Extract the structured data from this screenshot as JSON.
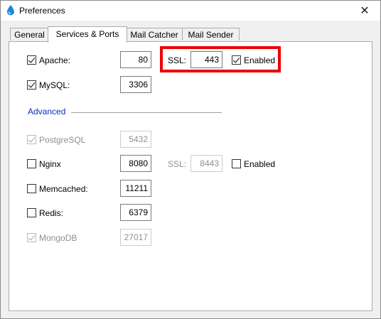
{
  "window": {
    "title": "Preferences",
    "close_glyph": "✕"
  },
  "tabs": [
    {
      "label": "General",
      "active": false
    },
    {
      "label": "Services & Ports",
      "active": true
    },
    {
      "label": "Mail Catcher",
      "active": false
    },
    {
      "label": "Mail Sender",
      "active": false
    }
  ],
  "services": {
    "apache": {
      "label": "Apache:",
      "checked": true,
      "port": "80",
      "ssl_label": "SSL:",
      "ssl_port": "443",
      "ssl_enabled_label": "Enabled",
      "ssl_enabled": true
    },
    "mysql": {
      "label": "MySQL:",
      "checked": true,
      "port": "3306"
    },
    "advanced_heading": "Advanced",
    "postgresql": {
      "label": "PostgreSQL",
      "checked": true,
      "disabled": true,
      "port": "5432"
    },
    "nginx": {
      "label": "Nginx",
      "checked": false,
      "port": "8080",
      "ssl_label": "SSL:",
      "ssl_port": "8443",
      "ssl_enabled_label": "Enabled",
      "ssl_enabled": false
    },
    "memcached": {
      "label": "Memcached:",
      "checked": false,
      "port": "11211"
    },
    "redis": {
      "label": "Redis:",
      "checked": false,
      "port": "6379"
    },
    "mongodb": {
      "label": "MongoDB",
      "checked": true,
      "disabled": true,
      "port": "27017"
    }
  },
  "icons": {
    "app": "water-drop-icon",
    "close": "close-icon"
  },
  "colors": {
    "highlight": "#ee0000",
    "advanced_link": "#0033bb",
    "app_icon": "#1a88d8"
  }
}
